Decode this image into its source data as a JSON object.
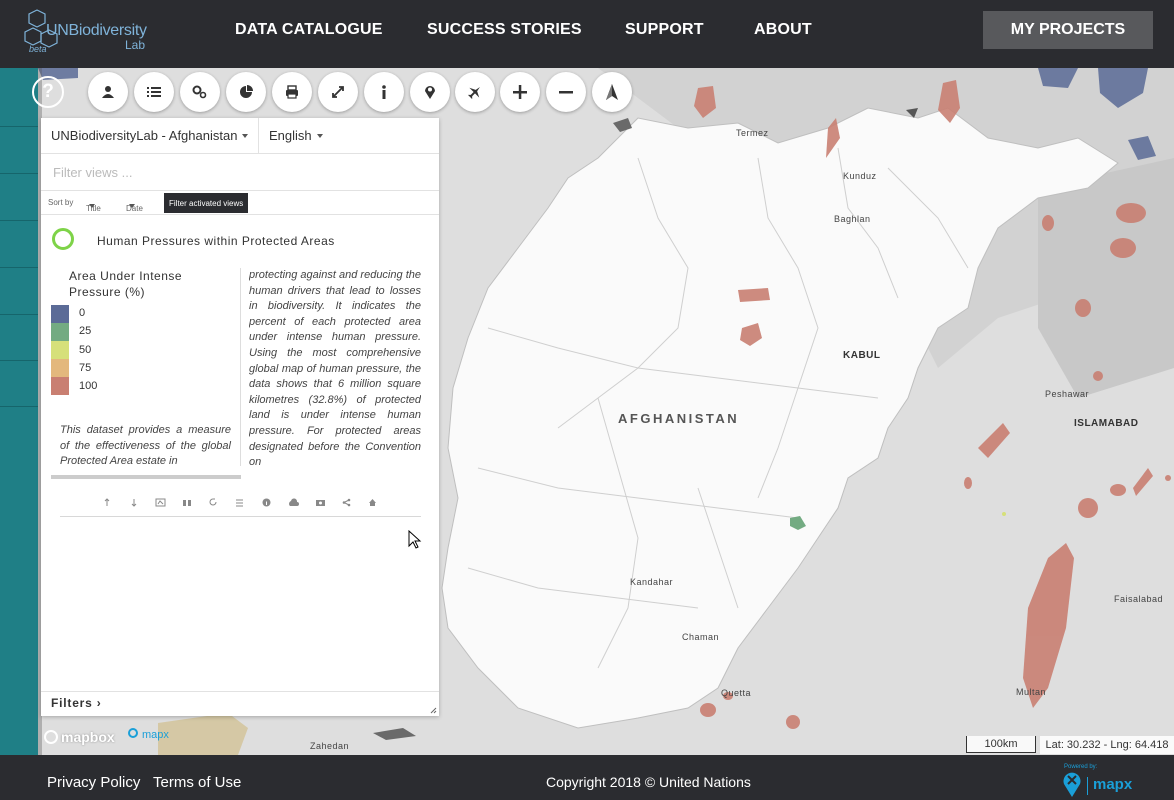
{
  "header": {
    "logo_text_main": "UNBiodiversity",
    "logo_text_sub": "Lab",
    "logo_beta": "beta",
    "nav": [
      "DATA CATALOGUE",
      "SUCCESS STORIES",
      "SUPPORT",
      "ABOUT"
    ],
    "my_projects": "MY PROJECTS"
  },
  "toolbar": {
    "help_label": "?",
    "icons": [
      "user-icon",
      "list-icon",
      "settings-icon",
      "pie-chart-icon",
      "print-icon",
      "fullscreen-icon",
      "info-icon",
      "location-icon",
      "airplane-icon",
      "zoom-in-icon",
      "zoom-out-icon",
      "compass-icon"
    ]
  },
  "panel": {
    "project": "UNBiodiversityLab - Afghanistan",
    "language": "English",
    "filter_placeholder": "Filter views ...",
    "sort_by": "Sort by",
    "sort_title": "Title",
    "sort_date": "Date",
    "filter_activated": "Filter activated views",
    "view_title": "Human Pressures within Protected Areas",
    "legend": {
      "title": "Area Under Intense Pressure (%)",
      "items": [
        {
          "label": "0",
          "color": "#5b6b97"
        },
        {
          "label": "25",
          "color": "#73ab82"
        },
        {
          "label": "50",
          "color": "#d6e07a"
        },
        {
          "label": "75",
          "color": "#e3b87d"
        },
        {
          "label": "100",
          "color": "#c97f72"
        }
      ]
    },
    "description_left": "This dataset provides a measure of the effectiveness of the global Protected Area estate in",
    "description_right": "protecting against and reducing the human drivers that lead to losses in biodiversity. It indicates the percent of each protected area under intense human pressure. Using the most comprehensive global map of human pressure, the data shows that 6 million square kilometres (32.8%) of protected land is under intense human pressure. For protected areas designated before the Convention on",
    "controls": [
      "move-up-icon",
      "move-down-icon",
      "screen-icon",
      "binoculars-icon",
      "reset-icon",
      "sliders-icon",
      "info-icon",
      "download-icon",
      "camera-icon",
      "share-icon",
      "home-icon"
    ],
    "filters_label": "Filters ›"
  },
  "map": {
    "country_label": "AFGHANISTAN",
    "cities": [
      "Termez",
      "Kunduz",
      "Baghlan",
      "KABUL",
      "Peshawar",
      "ISLAMABAD",
      "Kandahar",
      "Chaman",
      "Quetta",
      "Zahedan",
      "Faisalabad",
      "Multan"
    ],
    "scale": "100km",
    "coords": "Lat: 30.232 - Lng: 64.418",
    "mapbox": "mapbox",
    "mapx": "mapx"
  },
  "footer": {
    "privacy": "Privacy Policy",
    "terms": "Terms of Use",
    "copyright": "Copyright 2018 © United Nations",
    "powered_by": "Powered by:",
    "mapx_logo": "mapx"
  }
}
